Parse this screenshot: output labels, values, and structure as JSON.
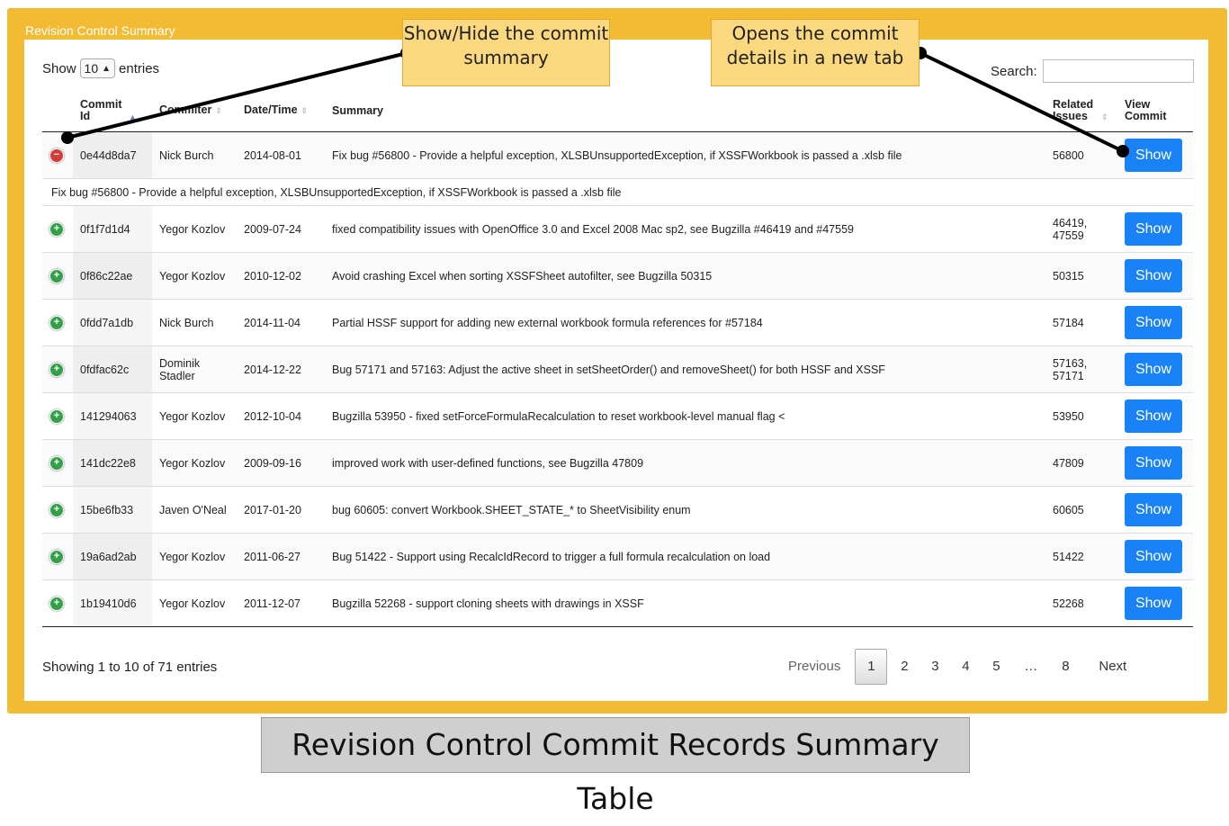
{
  "panel": {
    "title": "Revision Control Summary"
  },
  "length_menu": {
    "prefix": "Show",
    "value": "10",
    "suffix": "entries"
  },
  "search": {
    "label": "Search:",
    "value": ""
  },
  "table": {
    "headers": [
      {
        "label": "Commit Id",
        "sort": "asc"
      },
      {
        "label": "Commiter",
        "sort": "none"
      },
      {
        "label": "Date/Time",
        "sort": "none"
      },
      {
        "label": "Summary",
        "sort": "none"
      },
      {
        "label": "Related Issues",
        "sort": "none"
      },
      {
        "label": "View Commit",
        "sort": "none"
      }
    ],
    "expanded_detail": "Fix bug #56800 - Provide a helpful exception, XLSBUnsupportedException, if XSSFWorkbook is passed a .xlsb file",
    "button_label": "Show",
    "rows": [
      {
        "id": "0e44d8da7",
        "committer": "Nick Burch",
        "date": "2014-08-01",
        "summary": "Fix bug #56800 - Provide a helpful exception, XLSBUnsupportedException, if XSSFWorkbook is passed a .xlsb file",
        "issues": "56800",
        "expanded": true
      },
      {
        "id": "0f1f7d1d4",
        "committer": "Yegor Kozlov",
        "date": "2009-07-24",
        "summary": "fixed compatibility issues with OpenOffice 3.0 and Excel 2008 Mac sp2, see Bugzilla #46419 and #47559",
        "issues": "46419, 47559",
        "expanded": false
      },
      {
        "id": "0f86c22ae",
        "committer": "Yegor Kozlov",
        "date": "2010-12-02",
        "summary": "Avoid crashing Excel when sorting XSSFSheet autofilter, see Bugzilla 50315",
        "issues": "50315",
        "expanded": false
      },
      {
        "id": "0fdd7a1db",
        "committer": "Nick Burch",
        "date": "2014-11-04",
        "summary": "Partial HSSF support for adding new external workbook formula references for #57184",
        "issues": "57184",
        "expanded": false
      },
      {
        "id": "0fdfac62c",
        "committer": "Dominik Stadler",
        "date": "2014-12-22",
        "summary": "Bug 57171 and 57163: Adjust the active sheet in setSheetOrder() and removeSheet() for both HSSF and XSSF",
        "issues": "57163, 57171",
        "expanded": false
      },
      {
        "id": "141294063",
        "committer": "Yegor Kozlov",
        "date": "2012-10-04",
        "summary": "Bugzilla 53950 - fixed setForceFormulaRecalculation to reset workbook-level manual flag <",
        "issues": "53950",
        "expanded": false
      },
      {
        "id": "141dc22e8",
        "committer": "Yegor Kozlov",
        "date": "2009-09-16",
        "summary": "improved work with user-defined functions, see Bugzilla 47809",
        "issues": "47809",
        "expanded": false
      },
      {
        "id": "15be6fb33",
        "committer": "Javen O'Neal",
        "date": "2017-01-20",
        "summary": "bug 60605: convert Workbook.SHEET_STATE_* to SheetVisibility enum",
        "issues": "60605",
        "expanded": false
      },
      {
        "id": "19a6ad2ab",
        "committer": "Yegor Kozlov",
        "date": "2011-06-27",
        "summary": "Bug 51422 - Support using RecalcIdRecord to trigger a full formula recalculation on load",
        "issues": "51422",
        "expanded": false
      },
      {
        "id": "1b19410d6",
        "committer": "Yegor Kozlov",
        "date": "2011-12-07",
        "summary": "Bugzilla 52268 - support cloning sheets with drawings in XSSF",
        "issues": "52268",
        "expanded": false
      }
    ]
  },
  "footer": {
    "info": "Showing 1 to 10 of 71 entries",
    "pagination": {
      "previous": "Previous",
      "pages": [
        "1",
        "2",
        "3",
        "4",
        "5",
        "…",
        "8"
      ],
      "current": "1",
      "next": "Next"
    }
  },
  "callouts": {
    "toggle": "Show/Hide the commit summary",
    "show": "Opens the commit details in a new tab"
  },
  "caption": "Revision Control Commit Records Summary Table",
  "colors": {
    "panel": "#f3bb34",
    "button": "#1a82f7",
    "callout": "#fcd87e",
    "collapse": "#d33a3a",
    "expand": "#33a04a"
  }
}
